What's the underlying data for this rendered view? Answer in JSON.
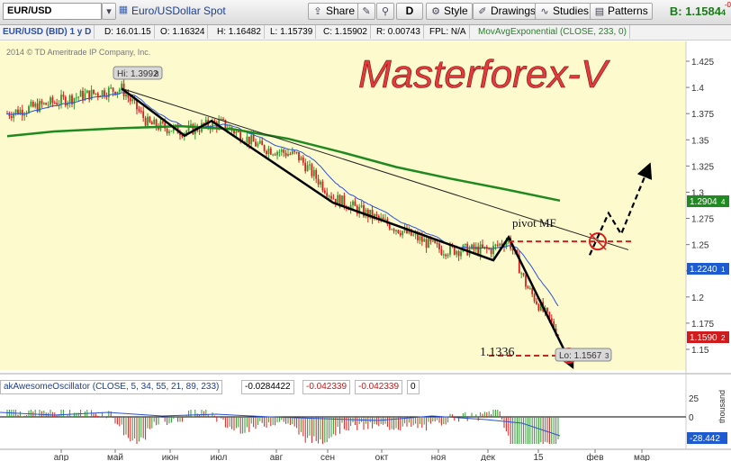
{
  "toolbar": {
    "symbol": "EUR/USD",
    "description": "Euro/USDollar Spot",
    "share_label": "Share",
    "d_label": "D",
    "style_label": "Style",
    "drawings_label": "Drawings",
    "studies_label": "Studies",
    "patterns_label": "Patterns",
    "quote_label": "B: 1.1584",
    "quote_frac": "4",
    "quote_change": "-0"
  },
  "infobar": {
    "symbol": "EUR/USD (BID) 1 y D",
    "date": "D: 16.01.15",
    "open": "O: 1.16324",
    "high": "H: 1.16482",
    "low": "L: 1.15739",
    "close": "C: 1.15902",
    "range": "R: 0.00743",
    "fpl": "FPL: N/A",
    "study": "MovAvgExponential (CLOSE, 233, 0)"
  },
  "chart_data": {
    "type": "candlestick",
    "title": "Masterforex-V",
    "copyright": "2014 © TD Ameritrade IP Company, Inc.",
    "y_ticks": [
      1.425,
      1.4,
      1.375,
      1.35,
      1.325,
      1.3,
      1.275,
      1.25,
      1.225,
      1.2,
      1.175,
      1.15
    ],
    "ylim": [
      1.13,
      1.44
    ],
    "x_ticks": [
      "апр",
      "май",
      "июн",
      "июл",
      "авг",
      "сен",
      "окт",
      "ноя",
      "дек",
      "15",
      "фев",
      "мар"
    ],
    "hi_label": "Hi: 1.3992",
    "hi_label_small": "8",
    "lo_label": "Lo: 1.1567",
    "lo_label_small": "3",
    "price_tags": [
      {
        "label": "1.2904",
        "small": "4",
        "color": "#1f8a1f"
      },
      {
        "label": "1.2240",
        "small": "1",
        "color": "#1e5bd0"
      },
      {
        "label": "1.1590",
        "small": "2",
        "color": "#d01c1c"
      }
    ],
    "annotations": {
      "pivot": "pivot MF",
      "level": "1.1336"
    },
    "close_path": [
      [
        "apr",
        1.375
      ],
      [
        "may-early",
        1.392
      ],
      [
        "may",
        1.399
      ],
      [
        "may-end",
        1.365
      ],
      [
        "jun",
        1.358
      ],
      [
        "jun-end",
        1.365
      ],
      [
        "jul",
        1.366
      ],
      [
        "jul-end",
        1.343
      ],
      [
        "aug",
        1.335
      ],
      [
        "sep",
        1.295
      ],
      [
        "oct",
        1.27
      ],
      [
        "nov",
        1.245
      ],
      [
        "dec",
        1.245
      ],
      [
        "dec-mid",
        1.255
      ],
      [
        "dec-end",
        1.21
      ],
      [
        "jan",
        1.159
      ]
    ]
  },
  "oscillator": {
    "name": "akAwesomeOscillator (CLOSE, 5, 34, 55, 21, 89, 233)",
    "v1": "-0.0284422",
    "v2": "-0.042339",
    "v3": "-0.042339",
    "v4": "0",
    "y_ticks": [
      "25",
      "0"
    ],
    "value_tag": "-28.442",
    "unit_label": "thousand"
  }
}
